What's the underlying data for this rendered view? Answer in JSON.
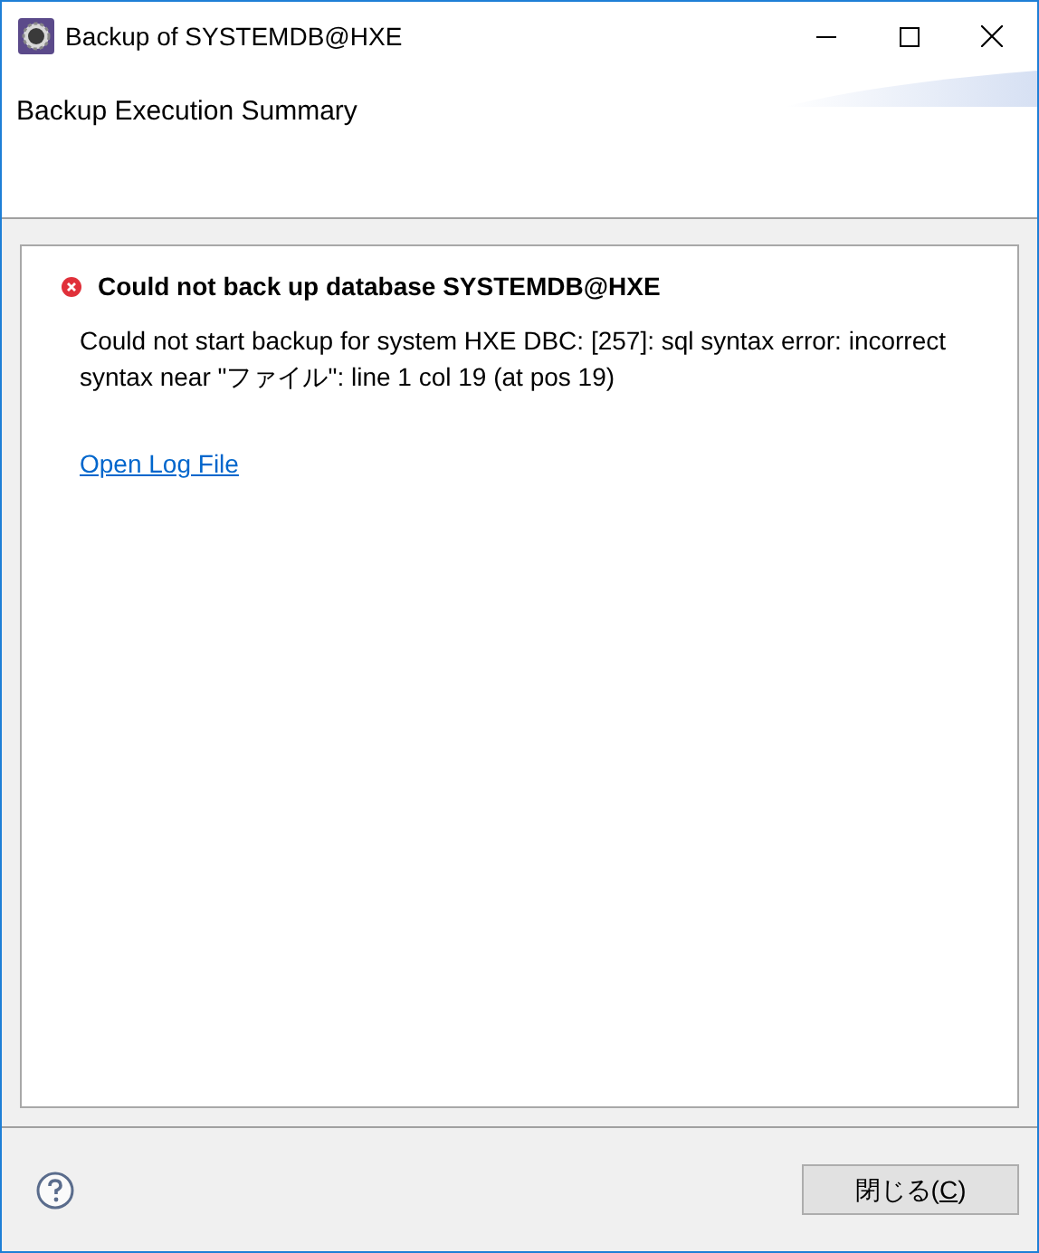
{
  "window": {
    "title": "Backup of SYSTEMDB@HXE"
  },
  "header": {
    "title": "Backup Execution Summary"
  },
  "message": {
    "title": "Could not back up database SYSTEMDB@HXE",
    "body": "Could not start backup for system HXE DBC: [257]: sql syntax error: incorrect syntax near \"ファイル\": line 1 col 19 (at pos 19)",
    "link": "Open Log File"
  },
  "close_button": {
    "label_before": "閉じる(",
    "mnemonic": "C",
    "label_after": ")"
  }
}
